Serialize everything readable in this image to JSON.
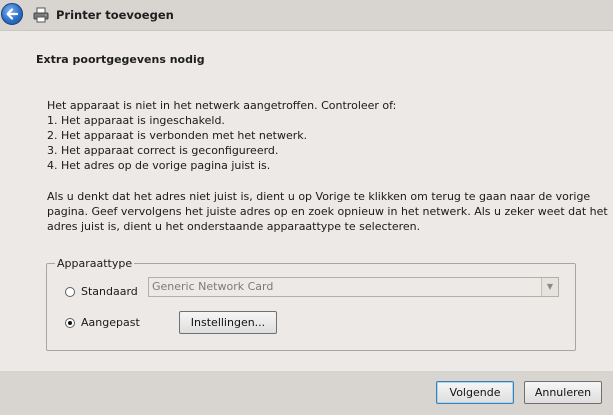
{
  "window": {
    "title": "Printer toevoegen"
  },
  "page": {
    "heading": "Extra poortgegevens nodig",
    "intro_lines": [
      "Het apparaat is niet in het netwerk aangetroffen. Controleer of:",
      "1. Het apparaat is ingeschakeld.",
      "2. Het apparaat is verbonden met het netwerk.",
      "3. Het apparaat correct is geconfigureerd.",
      "4. Het adres op de vorige pagina juist is."
    ],
    "paragraph_lines": [
      "Als u denkt dat het adres niet juist is, dient u op Vorige te klikken om terug te gaan naar de vorige",
      "pagina. Geef vervolgens het juiste adres op en zoek opnieuw in het netwerk. Als u zeker weet dat het",
      "adres juist is, dient u het onderstaande apparaattype te selecteren."
    ]
  },
  "device_type": {
    "group_label": "Apparaattype",
    "standard_label": "Standaard",
    "standard_selected": false,
    "standard_value": "Generic Network Card",
    "custom_label": "Aangepast",
    "custom_selected": true,
    "settings_button": "Instellingen..."
  },
  "footer": {
    "next_button": "Volgende",
    "cancel_button": "Annuleren"
  },
  "icons": {
    "back": "back-arrow-icon",
    "printer": "printer-icon"
  },
  "colors": {
    "accent": "#2a6fc9"
  }
}
